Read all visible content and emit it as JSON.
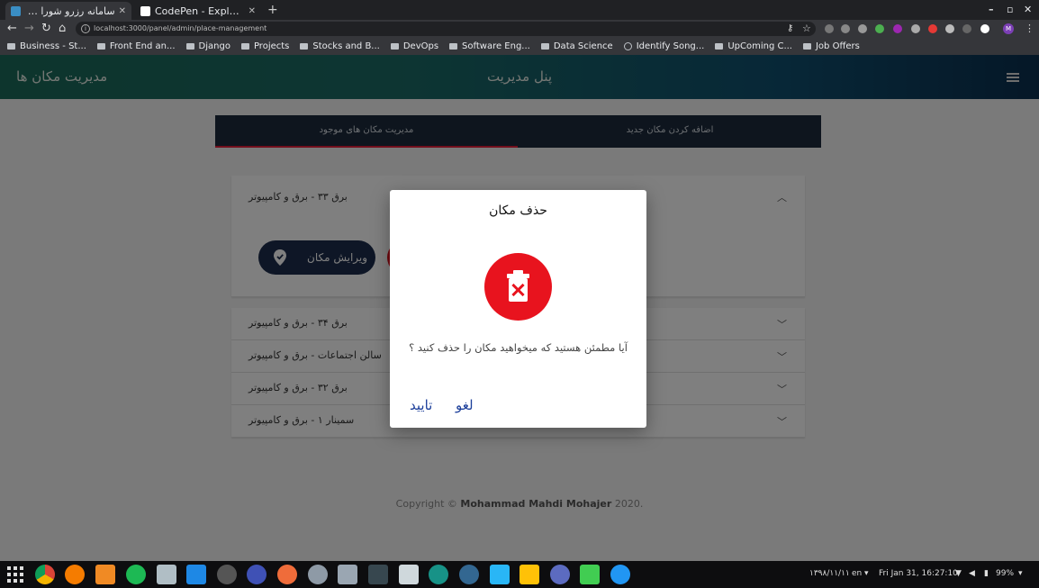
{
  "browser": {
    "tabs": [
      {
        "title": "سامانه رزرو شورا ها ، سم..",
        "active": true
      },
      {
        "title": "CodePen - Explore",
        "active": false
      }
    ],
    "url": "localhost:3000/panel/admin/place-management",
    "bookmarks": [
      {
        "label": "Business - St...",
        "icon": "folder-icon"
      },
      {
        "label": "Front End an...",
        "icon": "folder-icon"
      },
      {
        "label": "Django",
        "icon": "folder-icon"
      },
      {
        "label": "Projects",
        "icon": "folder-icon"
      },
      {
        "label": "Stocks and B...",
        "icon": "folder-icon"
      },
      {
        "label": "DevOps",
        "icon": "folder-icon"
      },
      {
        "label": "Software Eng...",
        "icon": "folder-icon"
      },
      {
        "label": "Data Science",
        "icon": "folder-icon"
      },
      {
        "label": "Identify Song...",
        "icon": "globe-icon"
      },
      {
        "label": "UpComing C...",
        "icon": "folder-icon"
      },
      {
        "label": "Job Offers",
        "icon": "folder-icon"
      }
    ],
    "profile_initial": "M"
  },
  "app": {
    "left_title": "مدیریت مکان ها",
    "center_title": "پنل مدیریت",
    "tabs": {
      "manage": "مدیریت مکان های موجود",
      "add": "اضافه کردن مکان جدید"
    },
    "places": [
      {
        "title": "برق ۳۳ - برق و کامپیوتر",
        "expanded": true
      },
      {
        "title": "برق ۳۴ - برق و کامپیوتر",
        "expanded": false
      },
      {
        "title": "سالن اجتماعات - برق و کامپیوتر",
        "expanded": false
      },
      {
        "title": "برق ۳۲ - برق و کامپیوتر",
        "expanded": false
      },
      {
        "title": "سمینار ۱ - برق و کامپیوتر",
        "expanded": false
      }
    ],
    "edit_button": "ویرایش مکان",
    "footer": {
      "prefix": "Copyright ©",
      "author": "Mohammad Mahdi Mohajer",
      "year": "2020."
    }
  },
  "dialog": {
    "title": "حذف مکان",
    "message": "آیا مطمئن هستید که میخواهید مکان را حذف کنید ؟",
    "cancel": "لغو",
    "confirm": "تایید",
    "icon": "trash-icon",
    "icon_color": "#e8131e"
  },
  "taskbar": {
    "date_persian": "۱۳۹۸/۱۱/۱۱",
    "lang": "en",
    "datetime": "Fri Jan 31, 16:27:10",
    "battery": "99%"
  },
  "colors": {
    "accent_red": "#e31c38",
    "navy": "#1c2c4c",
    "link_blue": "#1b3e9a"
  }
}
